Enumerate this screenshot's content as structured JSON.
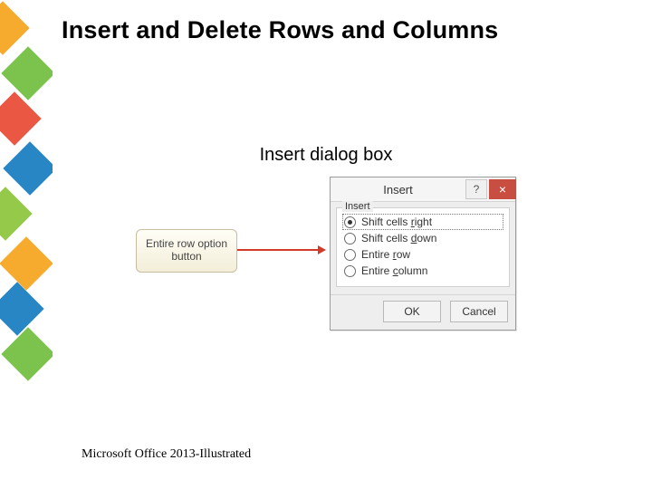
{
  "title": "Insert and Delete Rows and Columns",
  "subtitle": "Insert dialog box",
  "callout": "Entire row option button",
  "dialog": {
    "title": "Insert",
    "help": "?",
    "close": "×",
    "group_label": "Insert",
    "options": {
      "shift_right_pre": "Shift cells ",
      "shift_right_hot": "r",
      "shift_right_post": "ight",
      "shift_down_pre": "Shift cells ",
      "shift_down_hot": "d",
      "shift_down_post": "own",
      "entire_row_pre": "Entire ",
      "entire_row_hot": "r",
      "entire_row_post": "ow",
      "entire_col_pre": "Entire ",
      "entire_col_hot": "c",
      "entire_col_post": "olumn"
    },
    "ok": "OK",
    "cancel": "Cancel"
  },
  "footer": "Microsoft Office 2013-Illustrated"
}
